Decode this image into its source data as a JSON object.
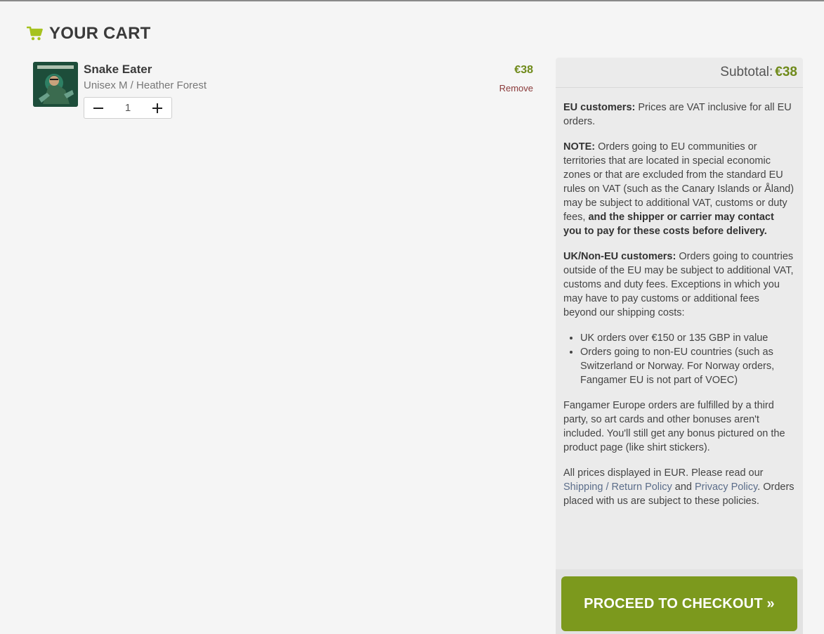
{
  "header": {
    "title": "YOUR CART",
    "icon": "shopping-cart-icon",
    "icon_color": "#a6c21f"
  },
  "cart": {
    "items": [
      {
        "name": "Snake Eater",
        "variant": "Unisex M / Heather Forest",
        "quantity": "1",
        "price": "€38",
        "remove_label": "Remove",
        "thumbnail_text": "METAL GEAR SOLID"
      }
    ]
  },
  "summary": {
    "subtotal_label": "Subtotal:",
    "subtotal_value": "€38",
    "eu_label": "EU customers:",
    "eu_text": " Prices are VAT inclusive for all EU orders.",
    "note_label": "NOTE:",
    "note_text": " Orders going to EU communities or territories that are located in special economic zones or that are excluded from the standard EU rules on VAT (such as the Canary Islands or Åland) may be subject to additional VAT, customs or duty fees, ",
    "note_bold": "and the shipper or carrier may contact you to pay for these costs before delivery.",
    "uk_label": "UK/Non-EU customers:",
    "uk_text": " Orders going to countries outside of the EU may be subject to additional VAT, customs and duty fees. Exceptions in which you may have to pay customs or additional fees beyond our shipping costs:",
    "exceptions": [
      "UK orders over €150 or 135 GBP in value",
      "Orders going to non-EU countries (such as Switzerland or Norway. For Norway orders, Fangamer EU is not part of VOEC)"
    ],
    "fulfillment_text": "Fangamer Europe orders are fulfilled by a third party, so art cards and other bonuses aren't included. You'll still get any bonus pictured on the product page (like shirt stickers).",
    "prices_text_before": "All prices displayed in EUR. Please read our ",
    "shipping_link": "Shipping / Return Policy",
    "and_text": " and ",
    "privacy_link": "Privacy Policy",
    "prices_text_after": ". Orders placed with us are subject to these policies.",
    "checkout_label": "PROCEED TO CHECKOUT »"
  },
  "colors": {
    "accent_green": "#7c991d",
    "price_green": "#6f8a1a",
    "remove_red": "#8a3a3a",
    "link_blue": "#5b6d8a"
  }
}
